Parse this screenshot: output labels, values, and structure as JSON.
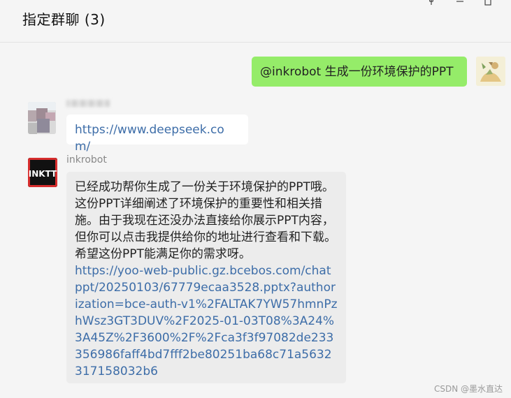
{
  "header": {
    "title": "指定群聊 (3)",
    "pin_icon": "pin-icon",
    "min_icon": "minimize-icon",
    "max_icon": "maximize-icon"
  },
  "messages": [
    {
      "type": "outgoing",
      "text": "@inkrobot 生成一份环境保护的PPT"
    },
    {
      "type": "incoming",
      "sender": "",
      "text": "https://www.deepseek.com/"
    },
    {
      "type": "incoming",
      "sender": "inkrobot",
      "text": "已经成功帮你生成了一份关于环境保护的PPT哦。这份PPT详细阐述了环境保护的重要性和相关措施。由于我现在还没办法直接给你展示PPT内容，但你可以点击我提供给你的地址进行查看和下载。希望这份PPT能满足你的需求呀。",
      "link": "https://yoo-web-public.gz.bcebos.com/chatppt/20250103/67779ecaa3528.pptx?authorization=bce-auth-v1%2FALTAK7YW57hmnPzhWsz3GT3DUV%2F2025-01-03T08%3A24%3A45Z%2F3600%2F%2Fca3f3f97082de233356986faff4bd7fff2be80251ba68c71a5632317158032b6"
    }
  ],
  "avatars": {
    "self": "user-avatar",
    "blurred": "blurred-user-avatar",
    "bot_logo": "INKTT"
  },
  "watermark": "CSDN @墨水直达",
  "colors": {
    "green_bubble": "#95ec69",
    "white_bubble": "#ffffff",
    "gray_bubble": "#ececec",
    "link": "#3d6da8",
    "background": "#f5f5f5"
  }
}
